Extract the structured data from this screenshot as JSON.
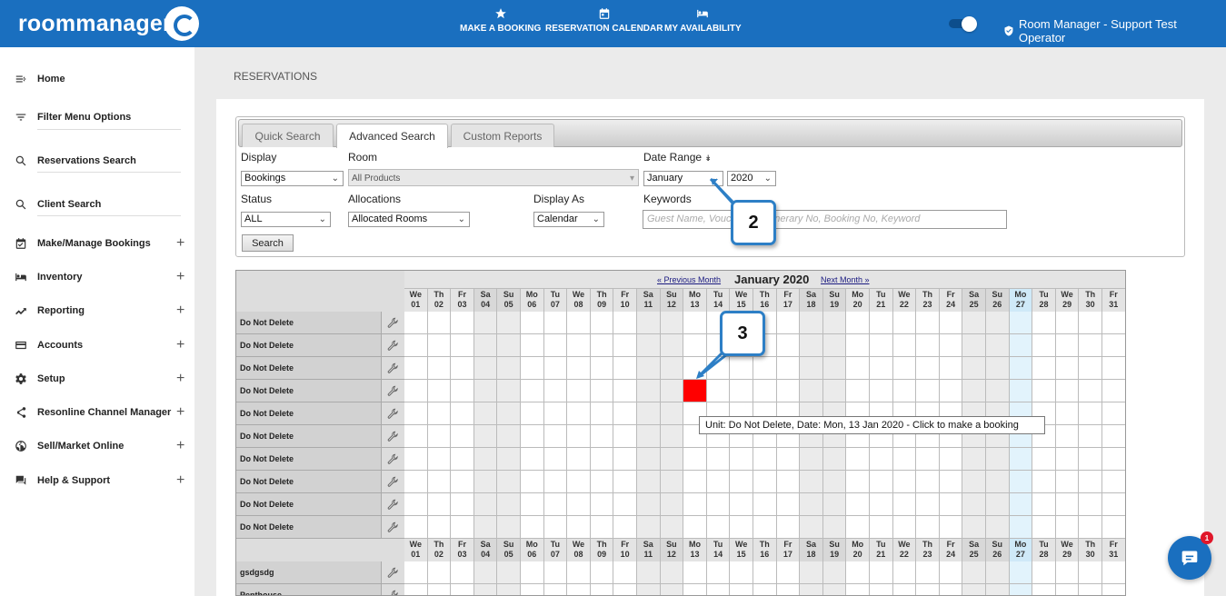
{
  "app": {
    "logo_text": "roommanager",
    "operator": "Room Manager - Support Test Operator",
    "top_nav": [
      {
        "label": "MAKE A BOOKING",
        "icon": "star-icon"
      },
      {
        "label": "RESERVATION CALENDAR",
        "icon": "calendar-icon"
      },
      {
        "label": "MY AVAILABILITY",
        "icon": "bed-icon"
      }
    ]
  },
  "sidebar": {
    "items": [
      {
        "label": "Home",
        "icon": "back-arrow-icon",
        "expandable": false
      },
      {
        "label": "Filter Menu Options",
        "icon": "filter-icon",
        "expandable": false
      },
      {
        "label": "Reservations Search",
        "icon": "search-icon",
        "expandable": false
      },
      {
        "label": "Client Search",
        "icon": "search-icon",
        "expandable": false
      },
      {
        "label": "Make/Manage Bookings",
        "icon": "calendar-check-icon",
        "expandable": true
      },
      {
        "label": "Inventory",
        "icon": "bed-icon",
        "expandable": true
      },
      {
        "label": "Reporting",
        "icon": "trend-icon",
        "expandable": true
      },
      {
        "label": "Accounts",
        "icon": "card-icon",
        "expandable": true
      },
      {
        "label": "Setup",
        "icon": "gear-icon",
        "expandable": true
      },
      {
        "label": "Resonline Channel Manager",
        "icon": "share-icon",
        "expandable": true
      },
      {
        "label": "Sell/Market Online",
        "icon": "globe-icon",
        "expandable": true
      },
      {
        "label": "Help & Support",
        "icon": "chat-icon",
        "expandable": true
      }
    ],
    "plus": "+"
  },
  "page": {
    "title": "RESERVATIONS"
  },
  "search": {
    "tabs": [
      "Quick Search",
      "Advanced Search",
      "Custom Reports"
    ],
    "active_tab": 1,
    "display_label": "Display",
    "display_value": "Bookings",
    "room_label": "Room",
    "room_value": "All Products",
    "date_range_label": "Date Range",
    "month_value": "January",
    "year_value": "2020",
    "status_label": "Status",
    "status_value": "ALL",
    "allocations_label": "Allocations",
    "allocations_value": "Allocated Rooms",
    "display_as_label": "Display As",
    "display_as_value": "Calendar",
    "keywords_label": "Keywords",
    "keywords_placeholder": "Guest Name, Voucher No, Itinerary No, Booking No, Keyword",
    "search_button": "Search"
  },
  "calendar": {
    "prev_link": "« Previous Month",
    "month_title": "January 2020",
    "next_link": "Next Month »",
    "days": [
      {
        "dow": "We",
        "d": "01"
      },
      {
        "dow": "Th",
        "d": "02"
      },
      {
        "dow": "Fr",
        "d": "03"
      },
      {
        "dow": "Sa",
        "d": "04"
      },
      {
        "dow": "Su",
        "d": "05"
      },
      {
        "dow": "Mo",
        "d": "06"
      },
      {
        "dow": "Tu",
        "d": "07"
      },
      {
        "dow": "We",
        "d": "08"
      },
      {
        "dow": "Th",
        "d": "09"
      },
      {
        "dow": "Fr",
        "d": "10"
      },
      {
        "dow": "Sa",
        "d": "11"
      },
      {
        "dow": "Su",
        "d": "12"
      },
      {
        "dow": "Mo",
        "d": "13"
      },
      {
        "dow": "Tu",
        "d": "14"
      },
      {
        "dow": "We",
        "d": "15"
      },
      {
        "dow": "Th",
        "d": "16"
      },
      {
        "dow": "Fr",
        "d": "17"
      },
      {
        "dow": "Sa",
        "d": "18"
      },
      {
        "dow": "Su",
        "d": "19"
      },
      {
        "dow": "Mo",
        "d": "20"
      },
      {
        "dow": "Tu",
        "d": "21"
      },
      {
        "dow": "We",
        "d": "22"
      },
      {
        "dow": "Th",
        "d": "23"
      },
      {
        "dow": "Fr",
        "d": "24"
      },
      {
        "dow": "Sa",
        "d": "25"
      },
      {
        "dow": "Su",
        "d": "26"
      },
      {
        "dow": "Mo",
        "d": "27"
      },
      {
        "dow": "Tu",
        "d": "28"
      },
      {
        "dow": "We",
        "d": "29"
      },
      {
        "dow": "Th",
        "d": "30"
      },
      {
        "dow": "Fr",
        "d": "31"
      }
    ],
    "today_day": "27",
    "units_group1": [
      "Do Not Delete",
      "Do Not Delete",
      "Do Not Delete",
      "Do Not Delete",
      "Do Not Delete",
      "Do Not Delete",
      "Do Not Delete",
      "Do Not Delete",
      "Do Not Delete",
      "Do Not Delete"
    ],
    "units_group2": [
      "gsdgsdg",
      "Penthouse"
    ],
    "selected_row": 3,
    "selected_day": "13",
    "tooltip": "Unit: Do Not Delete, Date: Mon, 13 Jan 2020 - Click to make a booking",
    "colors": {
      "selected": "#ff0000",
      "today": "#e2f3fc",
      "weekend": "#ebebeb"
    }
  },
  "callouts": [
    "2",
    "3"
  ],
  "chat_badge": "1"
}
